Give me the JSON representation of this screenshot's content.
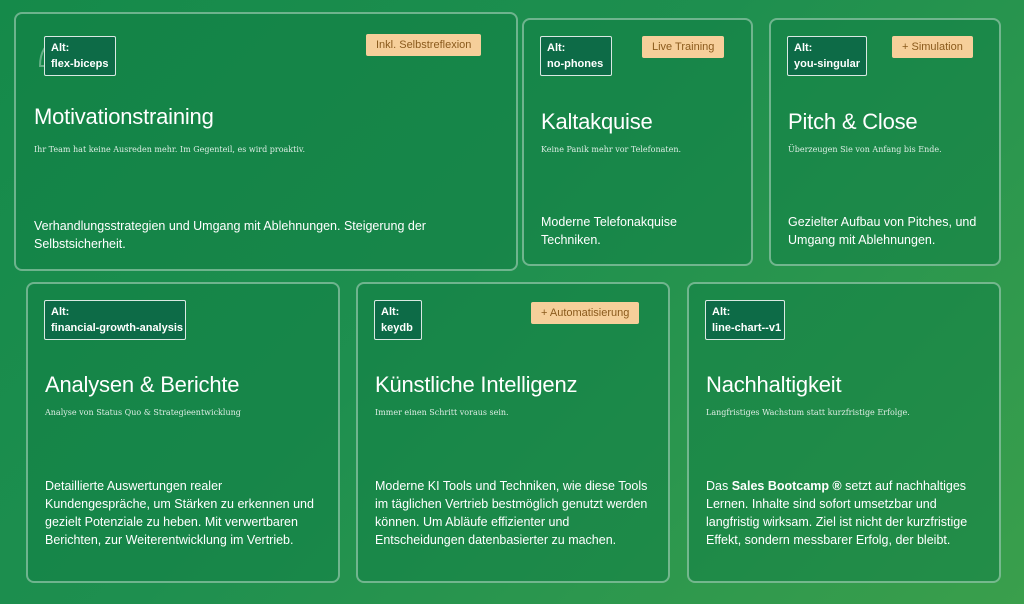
{
  "cards": [
    {
      "alt_prefix": "Alt:",
      "alt": "flex-biceps",
      "badge": "Inkl. Selbstreflexion",
      "title": "Motivationstraining",
      "subtitle": "Ihr Team hat keine Ausreden mehr. Im Gegenteil, es wird proaktiv.",
      "description": "Verhandlungsstrategien und Umgang mit Ablehnungen. Steigerung der Selbstsicherheit."
    },
    {
      "alt_prefix": "Alt:",
      "alt": "no-phones",
      "badge": "Live Training",
      "title": "Kaltakquise",
      "subtitle": "Keine Panik mehr vor Telefonaten.",
      "description": "Moderne Telefonakquise Techniken."
    },
    {
      "alt_prefix": "Alt:",
      "alt": "you-singular",
      "badge": "+ Simulation",
      "title": "Pitch & Close",
      "subtitle": "Überzeugen Sie von Anfang bis Ende.",
      "description": "Gezielter Aufbau von Pitches, und Umgang mit Ablehnungen."
    },
    {
      "alt_prefix": "Alt:",
      "alt": "financial-growth-analysis",
      "badge": "",
      "title": "Analysen & Berichte",
      "subtitle": "Analyse von Status Quo & Strategieentwicklung",
      "description": "Detaillierte Auswertungen realer Kundengespräche, um Stärken zu erkennen und gezielt Potenziale zu heben. Mit verwertbaren Berichten, zur Weiterentwicklung im Vertrieb."
    },
    {
      "alt_prefix": "Alt:",
      "alt": "keydb",
      "badge": "+ Automatisierung",
      "title": "Künstliche Intelligenz",
      "subtitle": "Immer einen Schritt voraus sein.",
      "description": "Moderne KI Tools und Techniken, wie diese Tools im täglichen Vertrieb bestmöglich genutzt werden können. Um Abläufe effizienter und Entscheidungen datenbasierter zu machen."
    },
    {
      "alt_prefix": "Alt:",
      "alt": "line-chart--v1",
      "badge": "",
      "title": "Nachhaltigkeit",
      "subtitle": "Langfristiges Wachstum statt kurzfristige Erfolge.",
      "description_pre": "Das ",
      "description_bold": "Sales Bootcamp ®",
      "description": " setzt auf nachhaltiges Lernen. Inhalte sind sofort umsetzbar und langfristig wirksam. Ziel ist nicht der kurzfristige Effekt, sondern messbarer Erfolg, der bleibt."
    }
  ]
}
